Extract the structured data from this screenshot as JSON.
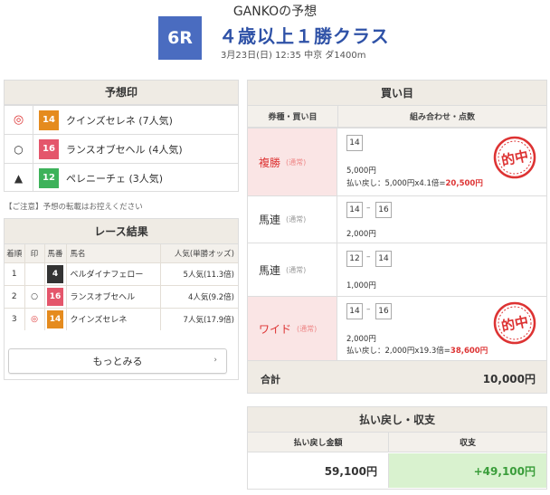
{
  "header": {
    "title": "GANKOの予想",
    "race_no": "6R",
    "race_name": "４歳以上１勝クラス",
    "race_info": "3月23日(日) 12:35 中京 ダ1400m"
  },
  "yoso": {
    "title": "予想印",
    "items": [
      {
        "mark": "◎",
        "num": "14",
        "color": "#e58b1e",
        "horse": "クインズセレネ",
        "pop": "(7人気)"
      },
      {
        "mark": "○",
        "num": "16",
        "color": "#e4566b",
        "horse": "ランスオブセヘル",
        "pop": "(4人気)"
      },
      {
        "mark": "▲",
        "num": "12",
        "color": "#3db25a",
        "horse": "ペレニーチェ",
        "pop": "(3人気)"
      }
    ],
    "note": "【ご注意】予想の転載はお控えください"
  },
  "race_result": {
    "title": "レース結果",
    "headers": [
      "着順",
      "印",
      "馬番",
      "馬名",
      "人気(単勝オッズ)"
    ],
    "rows": [
      {
        "rank": "1",
        "mark": "",
        "num": "4",
        "color": "#333333",
        "horse": "ベルダイナフェロー",
        "pop": "5人気(11.3倍)"
      },
      {
        "rank": "2",
        "mark": "○",
        "num": "16",
        "color": "#e4566b",
        "horse": "ランスオブセヘル",
        "pop": "4人気(9.2倍)"
      },
      {
        "rank": "3",
        "mark": "◎",
        "num": "14",
        "color": "#e58b1e",
        "horse": "クインズセレネ",
        "pop": "7人気(17.9倍)"
      }
    ],
    "more_label": "もっとみる",
    "more_icon": "chevron-right"
  },
  "kaime": {
    "title": "買い目",
    "col1": "券種・買い目",
    "col2": "組み合わせ・点数",
    "bets": [
      {
        "type": "複勝",
        "sub": "(通常)",
        "hit": true,
        "nums": [
          "14"
        ],
        "amount": "5,000円",
        "pay_label": "払い戻し：5,000円x4.1倍=",
        "pay_result": "20,500円"
      },
      {
        "type": "馬連",
        "sub": "(通常)",
        "hit": false,
        "nums": [
          "14",
          "16"
        ],
        "amount": "2,000円"
      },
      {
        "type": "馬連",
        "sub": "(通常)",
        "hit": false,
        "nums": [
          "12",
          "14"
        ],
        "amount": "1,000円"
      },
      {
        "type": "ワイド",
        "sub": "(通常)",
        "hit": true,
        "nums": [
          "14",
          "16"
        ],
        "amount": "2,000円",
        "pay_label": "払い戻し：2,000円x19.3倍=",
        "pay_result": "38,600円"
      }
    ],
    "stamp_text": "的中",
    "total_label": "合計",
    "total_value": "10,000円"
  },
  "haraimodoshi": {
    "title": "払い戻し・収支",
    "col1": "払い戻し金額",
    "col2": "収支",
    "payout": "59,100円",
    "balance": "+49,100円",
    "balance_color": "#3a9d3a",
    "balance_bg": "#d9f2cf"
  },
  "colors": {
    "accent_blue": "#4a6cc0",
    "race_name_blue": "#2f52a7",
    "hit_red": "#dd3333",
    "panel_beige": "#efebe4"
  }
}
